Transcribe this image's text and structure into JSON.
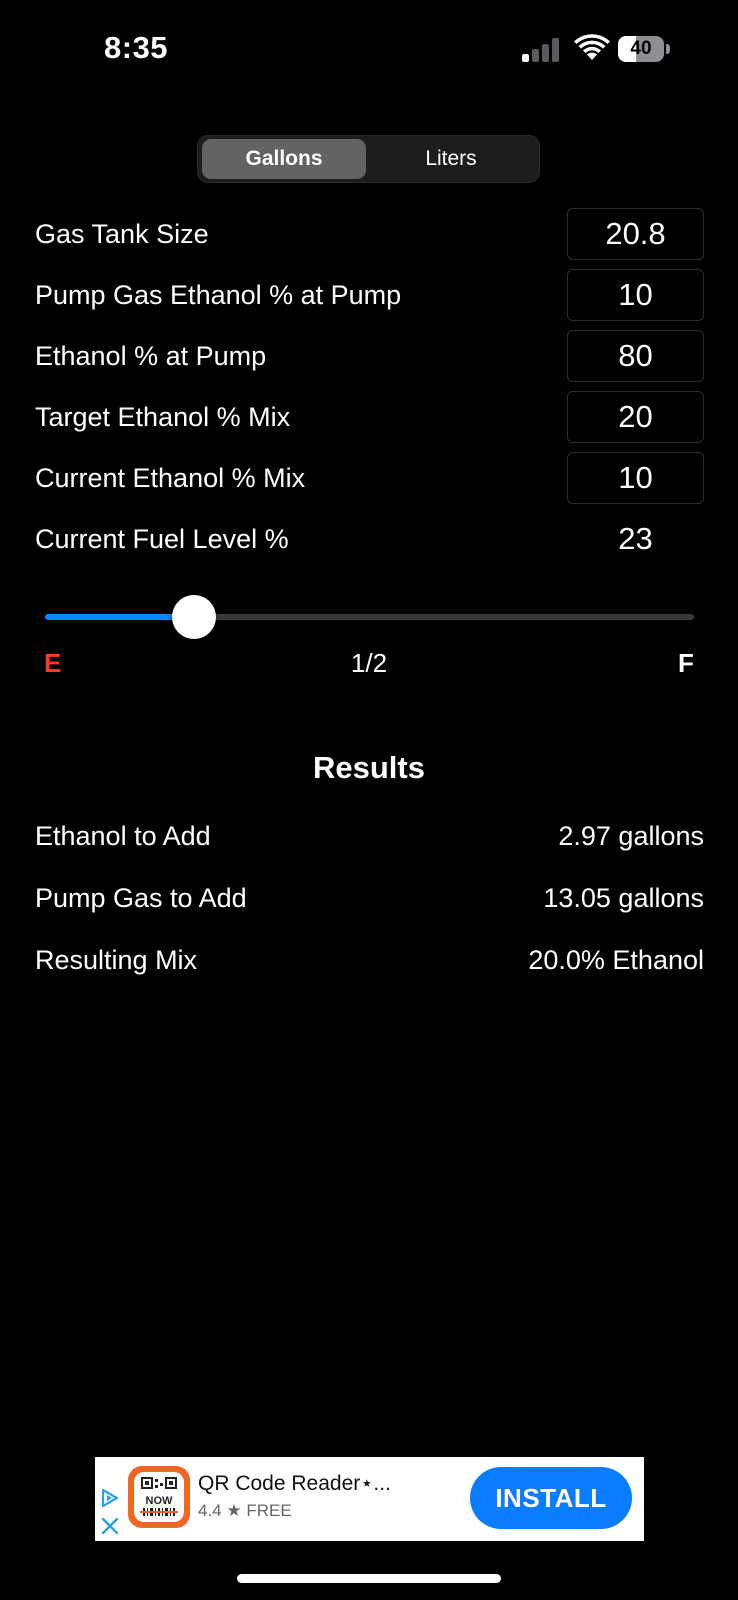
{
  "status_bar": {
    "time": "8:35",
    "battery_level": "40",
    "battery_fraction": 0.4,
    "signal_bars_active": 1,
    "signal_bars_total": 4
  },
  "unit_toggle": {
    "options": [
      "Gallons",
      "Liters"
    ],
    "selected": "Gallons"
  },
  "inputs": [
    {
      "label": "Gas Tank Size",
      "value": "20.8"
    },
    {
      "label": "Pump Gas Ethanol % at Pump",
      "value": "10"
    },
    {
      "label": "Ethanol % at Pump",
      "value": "80"
    },
    {
      "label": "Target Ethanol % Mix",
      "value": "20"
    },
    {
      "label": "Current Ethanol % Mix",
      "value": "10"
    }
  ],
  "fuel_level": {
    "label": "Current Fuel Level %",
    "value": "23",
    "slider_fraction": 0.23,
    "gauge_labels": {
      "empty": "E",
      "half": "1/2",
      "full": "F"
    }
  },
  "results": {
    "title": "Results",
    "rows": [
      {
        "label": "Ethanol to Add",
        "value": "2.97 gallons"
      },
      {
        "label": "Pump Gas to Add",
        "value": "13.05 gallons"
      },
      {
        "label": "Resulting Mix",
        "value": "20.0% Ethanol"
      }
    ]
  },
  "ad": {
    "app_title": "QR Code Reader⋆...",
    "rating_text": "4.4 ★ FREE",
    "install_label": "INSTALL",
    "app_icon_text": "NOW"
  },
  "colors": {
    "accent_blue": "#0a84ff",
    "empty_red": "#ff3b1f",
    "install_blue": "#0a7cff",
    "ad_icon_orange": "#f26522"
  }
}
